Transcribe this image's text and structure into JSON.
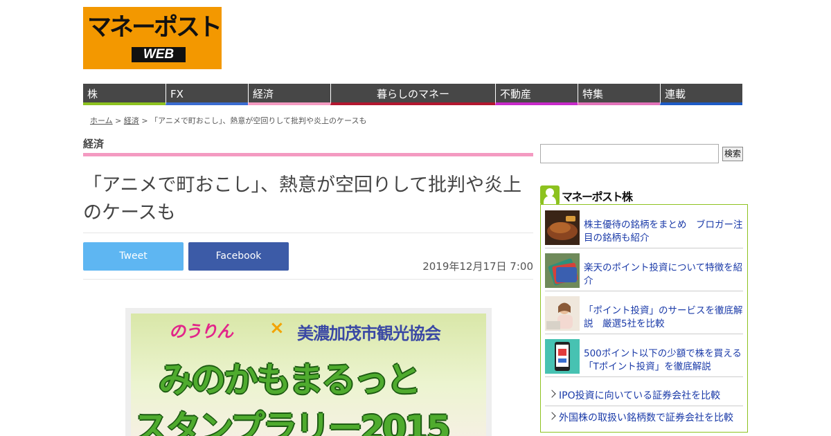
{
  "logo": {
    "main": "マネーポスト",
    "sub": "WEB",
    "color": "#f39800"
  },
  "nav": [
    {
      "label": "株",
      "color": "#8dc21f"
    },
    {
      "label": "FX",
      "color": "#3b6cd0"
    },
    {
      "label": "経済",
      "color": "#f49ac1"
    },
    {
      "label": "暮らしのマネー",
      "color": "#b2162e"
    },
    {
      "label": "不動産",
      "color": "#c729c9"
    },
    {
      "label": "特集",
      "color": "#e272b9"
    },
    {
      "label": "連載",
      "color": "#1e5bc6"
    }
  ],
  "breadcrumb": {
    "home": "ホーム",
    "sep1": " > ",
    "section": "経済",
    "sep2": " > ",
    "current": "「アニメで町おこし」、熱意が空回りして批判や炎上のケースも"
  },
  "article": {
    "section": "経済",
    "title": "「アニメで町おこし」、熱意が空回りして批判や炎上のケースも",
    "tweet": "Tweet",
    "facebook": "Facebook",
    "date": "2019年12月17日 7:00"
  },
  "hero": {
    "brand_a": "のうりん",
    "times": "×",
    "brand_b": "美濃加茂市観光協会",
    "line1": "みのかもまるっと",
    "line2": "スタンプラリー2015"
  },
  "search": {
    "value": "",
    "button": "検索"
  },
  "sidebar": {
    "title": "マネーポスト株",
    "accent": "#8dc21f",
    "items": [
      {
        "text": "株主優待の銘柄をまとめ　ブロガー注目の銘柄も紹介",
        "thumb": "food-photo"
      },
      {
        "text": "楽天のポイント投資について特徴を紹介",
        "thumb": "point-card-photo"
      },
      {
        "text": "「ポイント投資」のサービスを徹底解説　厳選5社を比較",
        "thumb": "woman-photo"
      },
      {
        "text": "500ポイント以下の少額で株を買える「Tポイント投資」を徹底解説",
        "thumb": "smartphone-photo"
      }
    ],
    "links": [
      {
        "text": "IPO投資に向いている証券会社を比較"
      },
      {
        "text": "外国株の取扱い銘柄数で証券会社を比較"
      }
    ]
  }
}
